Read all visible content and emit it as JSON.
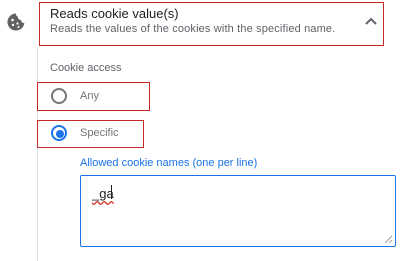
{
  "permission": {
    "title": "Reads cookie value(s)",
    "description": "Reads the values of the cookies with the specified name."
  },
  "cookie_access": {
    "label": "Cookie access",
    "options": [
      {
        "label": "Any",
        "selected": false
      },
      {
        "label": "Specific",
        "selected": true
      }
    ]
  },
  "allowed_names": {
    "label": "Allowed cookie names (one per line)",
    "value": "_ga"
  },
  "colors": {
    "accent": "#1a73e8",
    "highlight_border": "#c62828",
    "muted_text": "#5f6368"
  },
  "icons": {
    "permission": "cookie-icon",
    "collapse": "chevron-up-icon",
    "resize": "resize-grip-icon"
  }
}
